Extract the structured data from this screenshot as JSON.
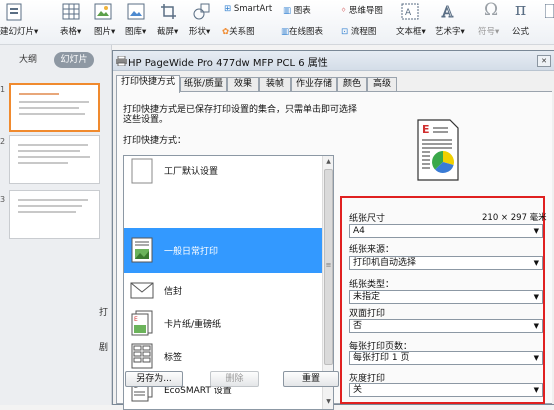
{
  "ribbon": {
    "items": [
      "建幻灯片",
      "表格",
      "图片",
      "图库",
      "截屏",
      "形状",
      "关系图",
      "SmartArt",
      "图表",
      "在线图表",
      "思维导图",
      "流程图",
      "文本框",
      "艺术字",
      "符号",
      "公式"
    ],
    "arrow": "▾"
  },
  "left_pane": {
    "tab_outline": "大纲",
    "tab_slides": "幻灯片",
    "slide_numbers": [
      "1",
      "2",
      "3"
    ]
  },
  "dialog": {
    "title": "HP PageWide Pro 477dw MFP PCL 6 属性",
    "close_glyph": "✕",
    "tabs": [
      "打印快捷方式",
      "纸张/质量",
      "效果",
      "装帧",
      "作业存储",
      "颜色",
      "高级"
    ],
    "description_line1": "打印快捷方式是已保存打印设置的集合，只需单击即可选择",
    "description_line2": "这些设置。",
    "shortcuts_label": "打印快捷方式：",
    "shortcuts": [
      "工厂默认设置",
      "一般日常打印",
      "信封",
      "卡片纸/重磅纸",
      "标签",
      "EcoSMART 设置"
    ],
    "selected_shortcut_index": 1,
    "scroll_up": "▲",
    "scroll_grip": "≡",
    "scroll_down": "▼",
    "save_as_label": "另存为...",
    "delete_label": "删除",
    "reset_label": "重置",
    "side_letters": [
      "打",
      "剧"
    ],
    "settings": {
      "paper_size_label": "纸张尺寸",
      "paper_size_dims": "210 × 297 毫米",
      "paper_size_value": "A4",
      "paper_source_label": "纸张来源：",
      "paper_source_value": "打印机自动选择",
      "paper_type_label": "纸张类型：",
      "paper_type_value": "未指定",
      "duplex_label": "双面打印",
      "duplex_value": "否",
      "pages_per_sheet_label": "每张打印页数：",
      "pages_per_sheet_value": "每张打印 1 页",
      "grayscale_label": "灰度打印",
      "grayscale_value": "关",
      "dropdown_arrow": "▼"
    },
    "preview_letter": "E"
  },
  "colors": {
    "selection": "#3399ff",
    "highlight_border": "#e02020",
    "slide_selected_border": "#f08a2e"
  }
}
